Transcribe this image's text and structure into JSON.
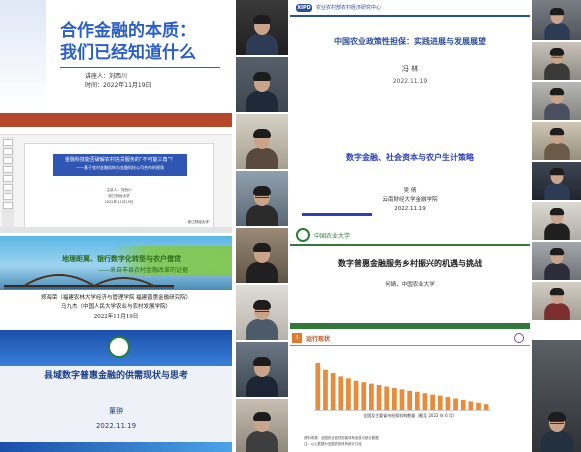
{
  "slide1": {
    "title_line1": "合作金融的本质：",
    "title_line2": "我们已经知道什么",
    "speaker": "讲座人：刘西川",
    "time": "时间：2022年11月19日"
  },
  "slide2": {
    "logo": "XIPD",
    "institution": "农业农村部农村经济研究中心",
    "title": "中国农业政策性担保：实践进展与发展展望",
    "speaker": "冯 林",
    "date": "2022.11.19"
  },
  "slide3": {
    "title_line1": "金融科技能否破解农村信贷服务的“不可能三角”？",
    "title_line2": "——基于农村金融机构与金融科技公司合作的视角",
    "presenter": "主讲人：刘西川",
    "affiliation": "浙江财经大学",
    "date": "2022年11月19日"
  },
  "slide4": {
    "head1": "地理距离、银行数字化转型与农户借贷",
    "head2": "——来自丰县农村金融改革的证据",
    "authors1": "郑海荣（福建农林大学经济与管理学院 福建普惠金融研究院）",
    "authors2": "马九杰（中国人民大学农业与农村发展学院）",
    "date": "2022年11月19日"
  },
  "slide5": {
    "title": "县域数字普惠金融的供需现状与思考",
    "speaker": "董翀",
    "date": "2022.11.19"
  },
  "slide6": {
    "title": "数字金融、社会资本与农户生计策略",
    "speaker": "吴 倩",
    "institution": "云南财经大学金融学院",
    "date": "2022.11.19"
  },
  "slide7": {
    "university": "中国农业大学",
    "title": "数字普惠金融服务乡村振兴的机遇与挑战",
    "speaker": "何婧，中国农业大学"
  },
  "slide8": {
    "section_number": "3",
    "section_title": "运行现状",
    "caption": "全国及主要省市担保机构数量（截至 2022 年 6 月）",
    "note1": "资料来源：全国农业信贷担保体系信息与统计数据",
    "note2": "注：以上数据为全国农担体系统计口径"
  },
  "chart_data": {
    "type": "bar",
    "title": "全国及主要省市担保机构数量（截至 2022 年 6 月）",
    "values": [
      98,
      84,
      77,
      70,
      66,
      61,
      58,
      55,
      52,
      49,
      46,
      43,
      40,
      38,
      35,
      32,
      30,
      27,
      24,
      21,
      18,
      15,
      12
    ],
    "colors": {
      "bar": "#e88b3a"
    }
  },
  "colors": {
    "blue_title": "#2b5fc8",
    "navy": "#2d4e9a",
    "ppt_red": "#b7472a",
    "green": "#2f7a3a",
    "orange": "#e07a2c"
  }
}
